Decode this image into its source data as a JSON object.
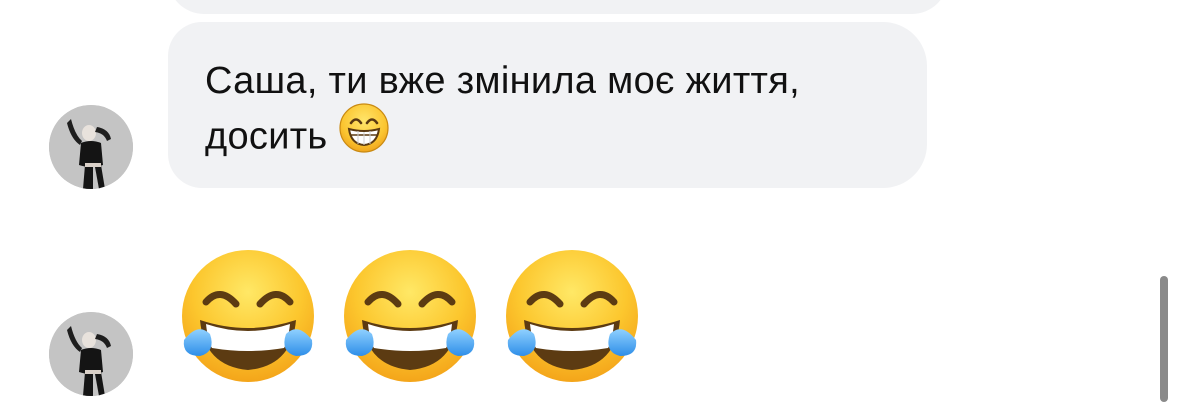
{
  "conversation": {
    "messages": [
      {
        "line1": "Саша, ти вже змінила моє життя,",
        "line2": "досить",
        "emoji": "beaming-face-with-smiling-eyes-icon"
      },
      {
        "emojis": [
          "face-with-tears-of-joy-icon",
          "face-with-tears-of-joy-icon",
          "face-with-tears-of-joy-icon"
        ]
      }
    ]
  },
  "colors": {
    "bubble_bg": "#f1f2f4",
    "text": "#111111",
    "scrollbar": "#8a8a8a"
  }
}
